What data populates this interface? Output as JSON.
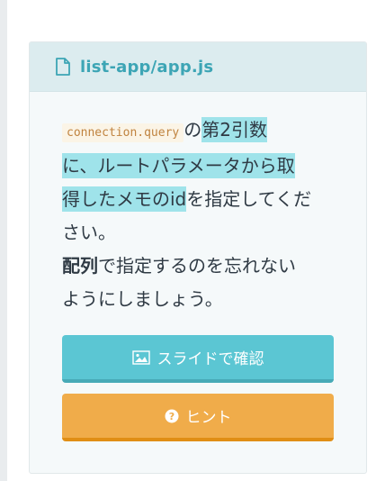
{
  "file": {
    "icon": "file-icon",
    "name": "list-app/app.js"
  },
  "instruction": {
    "code": "connection.query",
    "text_after_code": "の",
    "highlight_1": "第2引数",
    "highlight_2": "に、ルートパラメータから取",
    "highlight_3": "得したメモのid",
    "text_rest_1": "を指定してくだ",
    "text_rest_2": "さい。",
    "strong_word": "配列",
    "text_line_2a": "で指定するのを忘れない",
    "text_line_2b": "ようにしましょう。"
  },
  "buttons": {
    "slide": {
      "icon": "image-icon",
      "label": "スライドで確認",
      "color": "#5bc6d3"
    },
    "hint": {
      "icon": "question-circle-icon",
      "label": "ヒント",
      "color": "#f0ac4a"
    }
  }
}
